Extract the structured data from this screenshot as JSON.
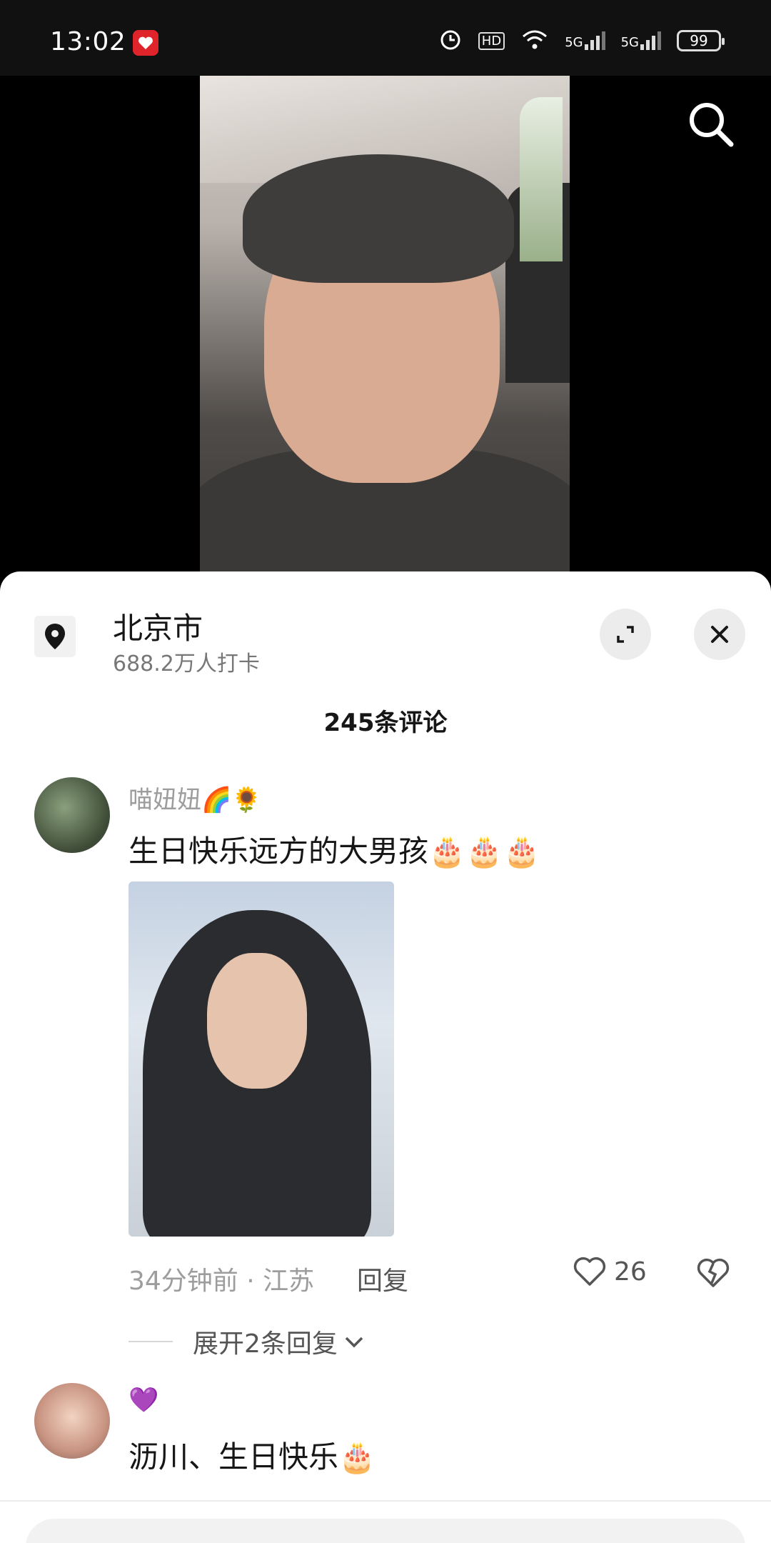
{
  "status_bar": {
    "time": "13:02",
    "network_label_1": "5G",
    "network_label_2": "5G",
    "hd_label": "HD",
    "battery": "99"
  },
  "location": {
    "title": "北京市",
    "subtitle": "688.2万人打卡"
  },
  "comments_header": "245条评论",
  "comments": [
    {
      "username": "喵妞妞🌈🌻",
      "text": "生日快乐远方的大男孩🎂🎂🎂",
      "meta": "34分钟前 · 江苏",
      "reply_label": "回复",
      "likes": "26",
      "expand_replies": "展开2条回复"
    },
    {
      "username": "💜",
      "text": "沥川、生日快乐🎂"
    }
  ],
  "colors": {
    "sheet_bg": "#ffffff",
    "status_bg": "#111111",
    "muted_text": "#9d9d9d"
  }
}
